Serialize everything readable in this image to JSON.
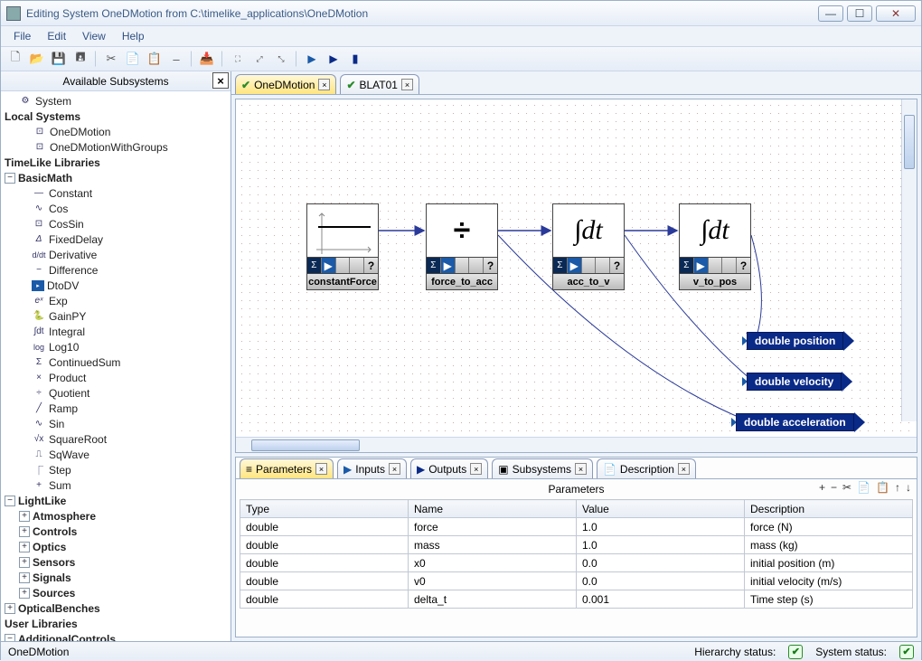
{
  "titlebar": {
    "text": "Editing System OneDMotion from C:\\timelike_applications\\OneDMotion"
  },
  "menu": {
    "file": "File",
    "edit": "Edit",
    "view": "View",
    "help": "Help"
  },
  "leftpanel": {
    "title": "Available Subsystems",
    "tree": {
      "system": "System",
      "local": "Local Systems",
      "onedm": "OneDMotion",
      "onedmg": "OneDMotionWithGroups",
      "tll": "TimeLike Libraries",
      "basicmath": "BasicMath",
      "bm": {
        "constant": "Constant",
        "cos": "Cos",
        "cossin": "CosSin",
        "fixeddelay": "FixedDelay",
        "derivative": "Derivative",
        "difference": "Difference",
        "dtodv": "DtoDV",
        "exp": "Exp",
        "gainpy": "GainPY",
        "integral": "Integral",
        "log10": "Log10",
        "contsum": "ContinuedSum",
        "product": "Product",
        "quotient": "Quotient",
        "ramp": "Ramp",
        "sin": "Sin",
        "sqrt": "SquareRoot",
        "sqwave": "SqWave",
        "step": "Step",
        "sum": "Sum"
      },
      "lightlike": "LightLike",
      "ll": {
        "atmos": "Atmosphere",
        "controls": "Controls",
        "optics": "Optics",
        "sensors": "Sensors",
        "signals": "Signals",
        "sources": "Sources"
      },
      "optbench": "OpticalBenches",
      "userlib": "User Libraries",
      "addctrl": "AdditionalControls"
    }
  },
  "tabs": {
    "main": "OneDMotion",
    "second": "BLAT01"
  },
  "blocks": {
    "b1": "constantForce",
    "b2": "force_to_acc",
    "b3": "acc_to_v",
    "b4": "v_to_pos",
    "out1": "double position",
    "out2": "double velocity",
    "out3": "double acceleration",
    "q": "?"
  },
  "btabs": {
    "params": "Parameters",
    "inputs": "Inputs",
    "outputs": "Outputs",
    "subsys": "Subsystems",
    "desc": "Description"
  },
  "paramspanel": {
    "title": "Parameters",
    "headers": {
      "type": "Type",
      "name": "Name",
      "value": "Value",
      "desc": "Description"
    },
    "rows": [
      {
        "type": "double",
        "name": "force",
        "value": "1.0",
        "desc": "force (N)"
      },
      {
        "type": "double",
        "name": "mass",
        "value": "1.0",
        "desc": "mass (kg)"
      },
      {
        "type": "double",
        "name": "x0",
        "value": "0.0",
        "desc": "initial position (m)"
      },
      {
        "type": "double",
        "name": "v0",
        "value": "0.0",
        "desc": "initial velocity (m/s)"
      },
      {
        "type": "double",
        "name": "delta_t",
        "value": "0.001",
        "desc": "Time step (s)"
      }
    ]
  },
  "status": {
    "left": "OneDMotion",
    "hier": "Hierarchy status:",
    "sys": "System status:"
  },
  "glyphs": {
    "plus": "+",
    "minus": "−",
    "scissors": "✂",
    "copy": "📋",
    "paste": "📄",
    "up": "↑",
    "down": "↓",
    "check": "✔",
    "x": "×",
    "min": "—",
    "max": "☐",
    "close": "✕"
  }
}
